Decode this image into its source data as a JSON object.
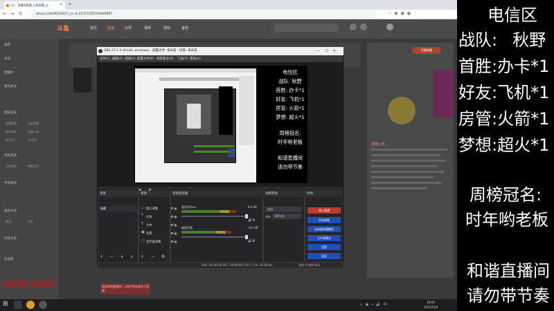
{
  "browser": {
    "tab_title": "(1) - 直播间直播_斗鱼直播_从...",
    "new_tab": "+",
    "url": "douyu.com/9532457_rn=0.22371055794480867",
    "site": {
      "logo": "斗鱼",
      "nav": [
        "首页",
        "直播",
        "分类",
        "视频",
        "游戏",
        "鱼吧"
      ],
      "sidebar_items": [
        "推荐",
        "关注",
        "直播中",
        "我的关注",
        "网游竞技",
        "单机热游",
        "手游休闲",
        "娱乐天地",
        "科技文化",
        "正能量"
      ],
      "sidebar_cells": [
        "英雄联盟",
        "王者荣耀",
        "和平精英",
        "穿越火线",
        "DOTA2",
        "CS:GO",
        "主机游戏",
        "绝地求生",
        "颜值",
        "户外"
      ],
      "right_button": "开播提醒",
      "right_title": "直播公告",
      "chat_notice": "欢迎来到直播间！斗鱼严禁未成年人直播"
    }
  },
  "obs": {
    "title": "OBS 27.1.3 (64-bit, windows) - 配置文件: 未命名 - 场景: 未命名",
    "menu": [
      "文件(F)",
      "编辑(E)",
      "视图(V)",
      "配置文件(P)",
      "场景集合(S)",
      "工具(T)",
      "帮助(H)"
    ],
    "docks": {
      "scenes": "场景",
      "sources": "来源",
      "mixer": "音频混音器",
      "transitions": "场景转场",
      "controls": "控件"
    },
    "scene_items": [
      "场景"
    ],
    "source_items": [
      "窗口采集",
      "文本",
      "文本",
      "背景",
      "显示器采集"
    ],
    "mixer": [
      {
        "label": "麦克风/Aux",
        "value": "0.0 dB",
        "level": 0.82
      },
      {
        "label": "桌面音频",
        "value": "-0.0 dB",
        "level": 0.75
      }
    ],
    "transition": {
      "type": "淡出",
      "duration_label": "时长",
      "duration": "300 ms"
    },
    "controls": [
      "停止直播",
      "开始录制",
      "启动虚拟摄像机",
      "工作室模式",
      "设置",
      "退出"
    ],
    "status": "LIVE: 00:00:00   REC: 00:00:00   CPU: 1.1%, 30.00 fps",
    "dropped": "丢帧 (0 帧/0 fps)"
  },
  "canvas_text": [
    "电信区",
    "战队: 秋野",
    "首胜: 办卡*1",
    "好友: 飞机*1",
    "房管: 火箭*1",
    "梦想: 超火*1",
    "周榜冠名:",
    "时年哟老板",
    "和谐直播间",
    "请勿带节奏"
  ],
  "taskbar": {
    "clock_time": "29:04",
    "clock_date": "2021/11/3"
  },
  "overlay": {
    "region": "电信区",
    "rows": [
      {
        "label": "战队:",
        "value": "秋野"
      },
      {
        "label": "首胜:",
        "value": "办卡*1"
      },
      {
        "label": "好友:",
        "value": "飞机*1"
      },
      {
        "label": "房管:",
        "value": "火箭*1"
      },
      {
        "label": "梦想:",
        "value": "超火*1"
      }
    ],
    "weekly_title": "周榜冠名:",
    "weekly_name": "时年哟老板",
    "rule1": "和谐直播间",
    "rule2": "请勿带节奏"
  },
  "colors": {
    "accent": "#ff8a3d",
    "stop_button": "#c0392b",
    "control_button": "#1f4fb0",
    "overlay_bg": "#000000"
  }
}
